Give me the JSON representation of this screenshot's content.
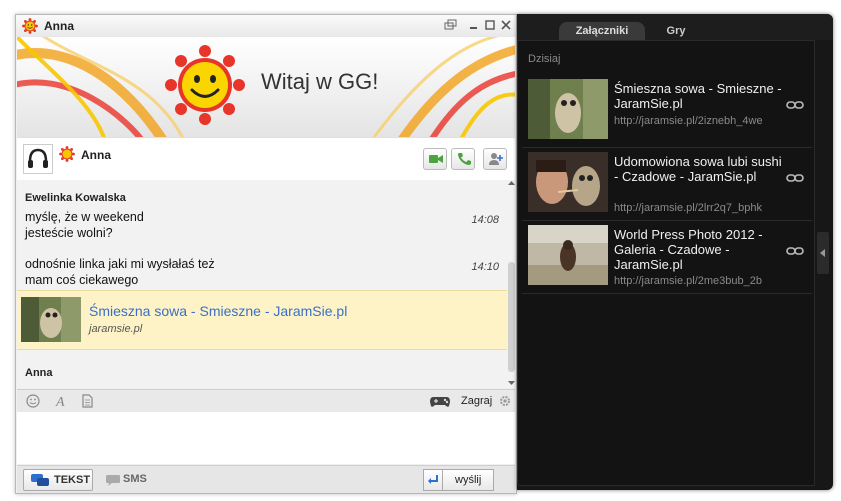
{
  "window": {
    "title": "Anna"
  },
  "banner": {
    "greeting": "Witaj w GG!"
  },
  "contact": {
    "name": "Anna"
  },
  "messages": [
    {
      "author": "Ewelinka Kowalska",
      "text": "myślę, że w weekend jesteście wolni?",
      "time": "14:08"
    },
    {
      "text": "odnośnie linka jaki mi wysłałaś też mam coś ciekawego",
      "time": "14:10"
    }
  ],
  "link_card": {
    "title": "Śmieszna sowa - Smieszne - JaramSie.pl",
    "domain": "jaramsie.pl"
  },
  "next_author": "Anna",
  "toolbar": {
    "game_label": "Zagraj"
  },
  "bottombar": {
    "text_mode": "TEKST",
    "sms_mode": "SMS",
    "send_label": "wyślij"
  },
  "panel": {
    "tabs": [
      "Załączniki",
      "Gry"
    ],
    "date_header": "Dzisiaj",
    "attachments": [
      {
        "title": "Śmieszna sowa - Smieszne - JaramSie.pl",
        "url": "http://jaramsie.pl/2iznebh_4wes..."
      },
      {
        "title": "Udomowiona sowa lubi sushi - Czadowe - JaramSie.pl",
        "url": "http://jaramsie.pl/2lrr2q7_bphk8w"
      },
      {
        "title": "World Press Photo 2012 - Galeria - Czadowe - JaramSie.pl",
        "url": "http://jaramsie.pl/2me3bub_2bd..."
      }
    ]
  },
  "colors": {
    "accent": "#3b6fc8",
    "highlight": "#fdf3c6",
    "panel_bg": "#131313"
  }
}
